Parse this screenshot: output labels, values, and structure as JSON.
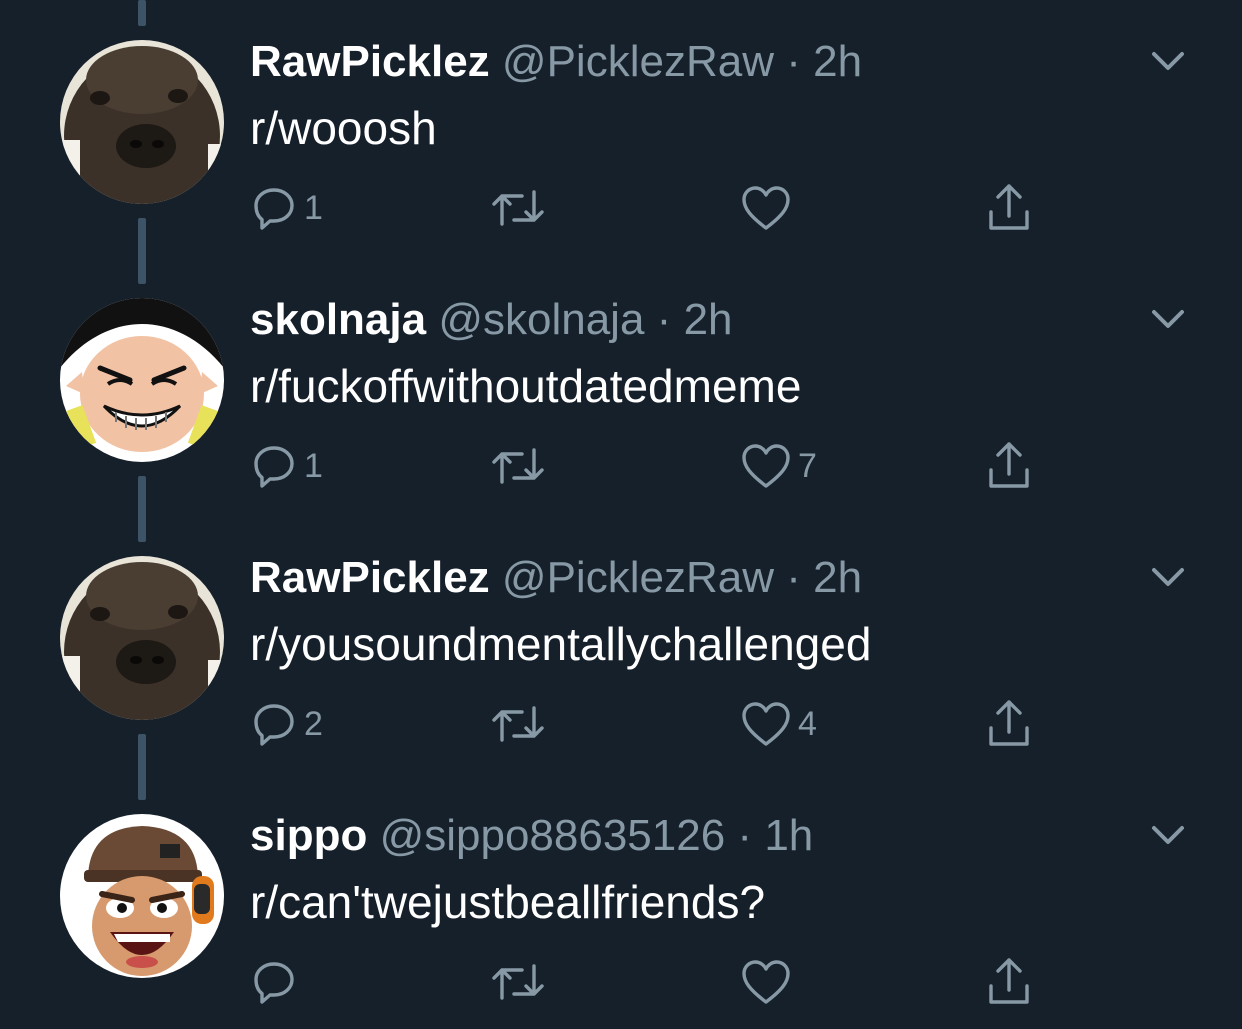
{
  "tweets": [
    {
      "display_name": "RawPicklez",
      "handle": "@PicklezRaw",
      "separator": "·",
      "time": "2h",
      "text": "r/wooosh",
      "reply_count": "1",
      "retweet_count": "",
      "like_count": "",
      "avatar_icon": "dog-avatar"
    },
    {
      "display_name": "skolnaja",
      "handle": "@skolnaja",
      "separator": "·",
      "time": "2h",
      "text": "r/fuckoffwithoutdatedmeme",
      "reply_count": "1",
      "retweet_count": "",
      "like_count": "7",
      "avatar_icon": "cartoon-face-avatar"
    },
    {
      "display_name": "RawPicklez",
      "handle": "@PicklezRaw",
      "separator": "·",
      "time": "2h",
      "text": "r/yousoundmentallychallenged",
      "reply_count": "2",
      "retweet_count": "",
      "like_count": "4",
      "avatar_icon": "dog-avatar"
    },
    {
      "display_name": "sippo",
      "handle": "@sippo88635126",
      "separator": "·",
      "time": "1h",
      "text": "r/can'twejustbeallfriends?",
      "reply_count": "",
      "retweet_count": "",
      "like_count": "",
      "avatar_icon": "scout-avatar"
    }
  ],
  "icons": {
    "reply": "reply-icon",
    "retweet": "retweet-icon",
    "like": "heart-icon",
    "share": "share-icon",
    "caret": "chevron-down-icon"
  },
  "colors": {
    "background": "#15202b",
    "text": "#ffffff",
    "secondary": "#8899a6",
    "thread_line": "#3d5466"
  }
}
